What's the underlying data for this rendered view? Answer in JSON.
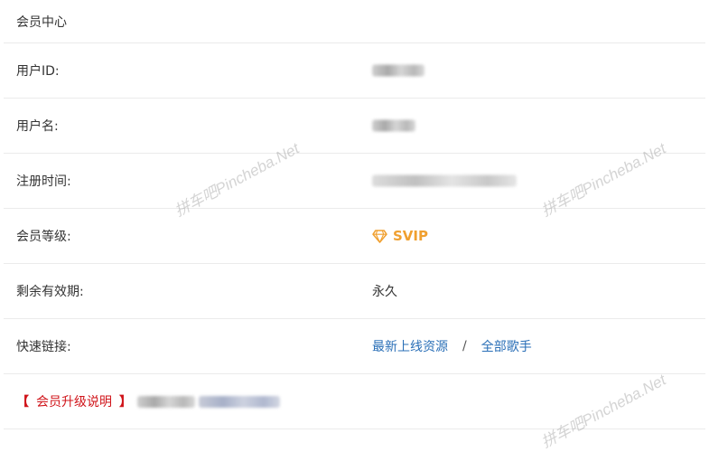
{
  "header": {
    "title": "会员中心"
  },
  "rows": {
    "user_id": {
      "label": "用户ID:"
    },
    "username": {
      "label": "用户名:"
    },
    "register_time": {
      "label": "注册时间:"
    },
    "level": {
      "label": "会员等级:",
      "value": "SVIP"
    },
    "validity": {
      "label": "剩余有效期:",
      "value": "永久"
    },
    "quick_links": {
      "label": "快速链接:",
      "links": [
        "最新上线资源",
        "全部歌手"
      ],
      "separator": "/"
    }
  },
  "upgrade": {
    "open": "【",
    "text": "会员升级说明",
    "close": "】"
  },
  "watermark": "拼车吧Pincheba.Net",
  "colors": {
    "accent": "#f0a030",
    "link": "#2a6fb7",
    "alert": "#d0141a"
  }
}
